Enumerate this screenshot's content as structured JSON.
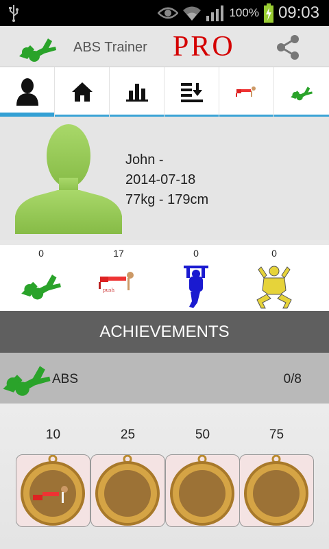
{
  "status_bar": {
    "battery_percent": "100%",
    "time": "09:03"
  },
  "app_bar": {
    "title": "ABS Trainer",
    "pro_label": "PRO"
  },
  "tabs": [
    {
      "name": "profile",
      "icon": "user-icon",
      "active": true
    },
    {
      "name": "home",
      "icon": "home-icon",
      "active": false
    },
    {
      "name": "stats",
      "icon": "bar-chart-icon",
      "active": false
    },
    {
      "name": "sort",
      "icon": "sort-download-icon",
      "active": false
    },
    {
      "name": "pushup",
      "icon": "pushup-icon",
      "active": false
    },
    {
      "name": "abs",
      "icon": "abs-icon",
      "active": false
    }
  ],
  "profile": {
    "name_line": "John -",
    "date": "2014-07-18",
    "body": "77kg - 179cm"
  },
  "exercise_stats": [
    {
      "name": "abs",
      "count": "0"
    },
    {
      "name": "pushups",
      "count": "17"
    },
    {
      "name": "pullups",
      "count": "0"
    },
    {
      "name": "squats",
      "count": "0"
    }
  ],
  "achievements": {
    "header": "ACHIEVEMENTS",
    "category": "ABS",
    "progress": "0/8",
    "medals": [
      {
        "target": "10",
        "unlocked": true
      },
      {
        "target": "25",
        "unlocked": false
      },
      {
        "target": "50",
        "unlocked": false
      },
      {
        "target": "75",
        "unlocked": false
      }
    ]
  },
  "colors": {
    "accent_blue": "#33a0d4",
    "figure_green": "#8fc93a",
    "pro_red": "#d40000",
    "header_gray": "#5f5f5f"
  }
}
